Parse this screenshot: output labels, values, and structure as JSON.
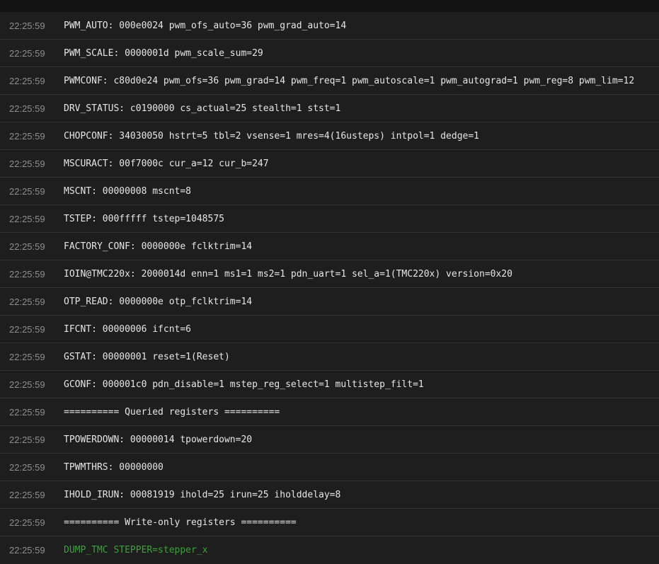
{
  "console": {
    "command_color": "#3f9f3f",
    "lines": [
      {
        "time": "22:25:59",
        "text": "PWM_AUTO: 000e0024 pwm_ofs_auto=36 pwm_grad_auto=14"
      },
      {
        "time": "22:25:59",
        "text": "PWM_SCALE: 0000001d pwm_scale_sum=29"
      },
      {
        "time": "22:25:59",
        "text": "PWMCONF: c80d0e24 pwm_ofs=36 pwm_grad=14 pwm_freq=1 pwm_autoscale=1 pwm_autograd=1 pwm_reg=8 pwm_lim=12"
      },
      {
        "time": "22:25:59",
        "text": "DRV_STATUS: c0190000 cs_actual=25 stealth=1 stst=1"
      },
      {
        "time": "22:25:59",
        "text": "CHOPCONF: 34030050 hstrt=5 tbl=2 vsense=1 mres=4(16usteps) intpol=1 dedge=1"
      },
      {
        "time": "22:25:59",
        "text": "MSCURACT: 00f7000c cur_a=12 cur_b=247"
      },
      {
        "time": "22:25:59",
        "text": "MSCNT: 00000008 mscnt=8"
      },
      {
        "time": "22:25:59",
        "text": "TSTEP: 000fffff tstep=1048575"
      },
      {
        "time": "22:25:59",
        "text": "FACTORY_CONF: 0000000e fclktrim=14"
      },
      {
        "time": "22:25:59",
        "text": "IOIN@TMC220x: 2000014d enn=1 ms1=1 ms2=1 pdn_uart=1 sel_a=1(TMC220x) version=0x20"
      },
      {
        "time": "22:25:59",
        "text": "OTP_READ: 0000000e otp_fclktrim=14"
      },
      {
        "time": "22:25:59",
        "text": "IFCNT: 00000006 ifcnt=6"
      },
      {
        "time": "22:25:59",
        "text": "GSTAT: 00000001 reset=1(Reset)"
      },
      {
        "time": "22:25:59",
        "text": "GCONF: 000001c0 pdn_disable=1 mstep_reg_select=1 multistep_filt=1"
      },
      {
        "time": "22:25:59",
        "text": "========== Queried registers =========="
      },
      {
        "time": "22:25:59",
        "text": "TPOWERDOWN: 00000014 tpowerdown=20"
      },
      {
        "time": "22:25:59",
        "text": "TPWMTHRS: 00000000"
      },
      {
        "time": "22:25:59",
        "text": "IHOLD_IRUN: 00081919 ihold=25 irun=25 iholddelay=8"
      },
      {
        "time": "22:25:59",
        "text": "========== Write-only registers =========="
      },
      {
        "time": "22:25:59",
        "text": "DUMP_TMC STEPPER=stepper_x",
        "is_command": true
      }
    ]
  }
}
